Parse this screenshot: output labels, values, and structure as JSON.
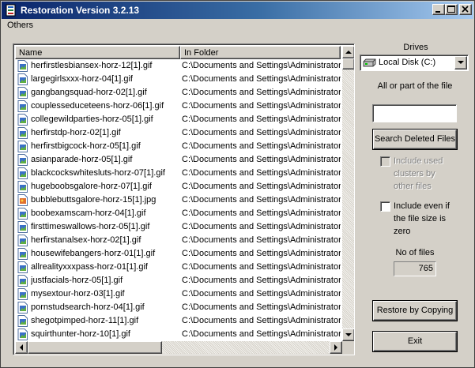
{
  "window": {
    "title": "Restoration Version 3.2.13"
  },
  "menu": {
    "items": [
      "Others"
    ]
  },
  "list": {
    "columns": [
      "Name",
      "In Folder"
    ],
    "rows": [
      {
        "name": "herfirstlesbiansex-horz-12[1].gif",
        "folder": "C:\\Documents and Settings\\Administrator\\L",
        "icon": "gif-file-icon"
      },
      {
        "name": "largegirlsxxx-horz-04[1].gif",
        "folder": "C:\\Documents and Settings\\Administrator\\L",
        "icon": "gif-file-icon"
      },
      {
        "name": "gangbangsquad-horz-02[1].gif",
        "folder": "C:\\Documents and Settings\\Administrator\\L",
        "icon": "gif-file-icon"
      },
      {
        "name": "couplesseduceteens-horz-06[1].gif",
        "folder": "C:\\Documents and Settings\\Administrator\\L",
        "icon": "gif-file-icon"
      },
      {
        "name": "collegewildparties-horz-05[1].gif",
        "folder": "C:\\Documents and Settings\\Administrator\\L",
        "icon": "gif-file-icon"
      },
      {
        "name": "herfirstdp-horz-02[1].gif",
        "folder": "C:\\Documents and Settings\\Administrator\\L",
        "icon": "gif-file-icon"
      },
      {
        "name": "herfirstbigcock-horz-05[1].gif",
        "folder": "C:\\Documents and Settings\\Administrator\\L",
        "icon": "gif-file-icon"
      },
      {
        "name": "asianparade-horz-05[1].gif",
        "folder": "C:\\Documents and Settings\\Administrator\\L",
        "icon": "gif-file-icon"
      },
      {
        "name": "blackcockswhitesluts-horz-07[1].gif",
        "folder": "C:\\Documents and Settings\\Administrator\\L",
        "icon": "gif-file-icon"
      },
      {
        "name": "hugeboobsgalore-horz-07[1].gif",
        "folder": "C:\\Documents and Settings\\Administrator\\L",
        "icon": "gif-file-icon"
      },
      {
        "name": "bubblebuttsgalore-horz-15[1].jpg",
        "folder": "C:\\Documents and Settings\\Administrator\\L",
        "icon": "jpg-file-icon"
      },
      {
        "name": "boobexamscam-horz-04[1].gif",
        "folder": "C:\\Documents and Settings\\Administrator\\L",
        "icon": "gif-file-icon"
      },
      {
        "name": "firsttimeswallows-horz-05[1].gif",
        "folder": "C:\\Documents and Settings\\Administrator\\L",
        "icon": "gif-file-icon"
      },
      {
        "name": "herfirstanalsex-horz-02[1].gif",
        "folder": "C:\\Documents and Settings\\Administrator\\L",
        "icon": "gif-file-icon"
      },
      {
        "name": "housewifebangers-horz-01[1].gif",
        "folder": "C:\\Documents and Settings\\Administrator\\L",
        "icon": "gif-file-icon"
      },
      {
        "name": "allrealityxxxpass-horz-01[1].gif",
        "folder": "C:\\Documents and Settings\\Administrator\\L",
        "icon": "gif-file-icon"
      },
      {
        "name": "justfacials-horz-05[1].gif",
        "folder": "C:\\Documents and Settings\\Administrator\\L",
        "icon": "gif-file-icon"
      },
      {
        "name": "mysextour-horz-03[1].gif",
        "folder": "C:\\Documents and Settings\\Administrator\\L",
        "icon": "gif-file-icon"
      },
      {
        "name": "pornstudsearch-horz-04[1].gif",
        "folder": "C:\\Documents and Settings\\Administrator\\L",
        "icon": "gif-file-icon"
      },
      {
        "name": "shegotpimped-horz-11[1].gif",
        "folder": "C:\\Documents and Settings\\Administrator\\L",
        "icon": "gif-file-icon"
      },
      {
        "name": "squirthunter-horz-10[1].gif",
        "folder": "C:\\Documents and Settings\\Administrator\\L",
        "icon": "gif-file-icon"
      }
    ]
  },
  "drives": {
    "label": "Drives",
    "selected": "Local Disk (C:)",
    "icon": "hard-drive-icon"
  },
  "search": {
    "label": "All or part of the file",
    "value": "",
    "button": "Search Deleted Files"
  },
  "options": {
    "include_used_clusters": {
      "label": "Include used clusters by other files",
      "checked": false,
      "enabled": false
    },
    "include_zero_size": {
      "label": "Include even if the file size is zero",
      "checked": false,
      "enabled": true
    }
  },
  "stats": {
    "label": "No of files",
    "count": "765"
  },
  "actions": {
    "restore": "Restore by Copying",
    "exit": "Exit"
  },
  "colors": {
    "titlebar_start": "#0a246a",
    "titlebar_end": "#a6caf0",
    "face": "#d4d0c8"
  }
}
